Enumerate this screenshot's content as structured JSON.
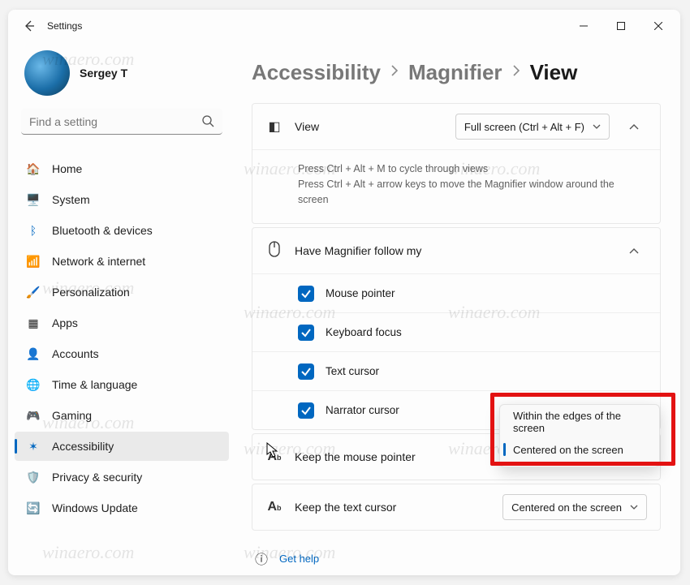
{
  "window": {
    "title": "Settings"
  },
  "user": {
    "name": "Sergey T"
  },
  "search": {
    "placeholder": "Find a setting"
  },
  "nav": {
    "items": [
      {
        "label": "Home"
      },
      {
        "label": "System"
      },
      {
        "label": "Bluetooth & devices"
      },
      {
        "label": "Network & internet"
      },
      {
        "label": "Personalization"
      },
      {
        "label": "Apps"
      },
      {
        "label": "Accounts"
      },
      {
        "label": "Time & language"
      },
      {
        "label": "Gaming"
      },
      {
        "label": "Accessibility"
      },
      {
        "label": "Privacy & security"
      },
      {
        "label": "Windows Update"
      }
    ]
  },
  "breadcrumb": {
    "accessibility": "Accessibility",
    "magnifier": "Magnifier",
    "view": "View"
  },
  "view_card": {
    "label": "View",
    "dropdown_value": "Full screen (Ctrl + Alt + F)",
    "desc_line1": "Press Ctrl + Alt + M to cycle through views",
    "desc_line2": "Press Ctrl + Alt + arrow keys to move the Magnifier window around the screen"
  },
  "follow_card": {
    "label": "Have Magnifier follow my",
    "items": [
      {
        "label": "Mouse pointer",
        "checked": true
      },
      {
        "label": "Keyboard focus",
        "checked": true
      },
      {
        "label": "Text cursor",
        "checked": true
      },
      {
        "label": "Narrator cursor",
        "checked": true
      }
    ]
  },
  "mouse_pointer_card": {
    "label": "Keep the mouse pointer"
  },
  "text_cursor_card": {
    "label": "Keep the text cursor",
    "dropdown_value": "Centered on the screen"
  },
  "popup": {
    "options": [
      {
        "label": "Within the edges of the screen"
      },
      {
        "label": "Centered on the screen"
      }
    ]
  },
  "help": {
    "label": "Get help"
  },
  "watermark": "winaero.com"
}
